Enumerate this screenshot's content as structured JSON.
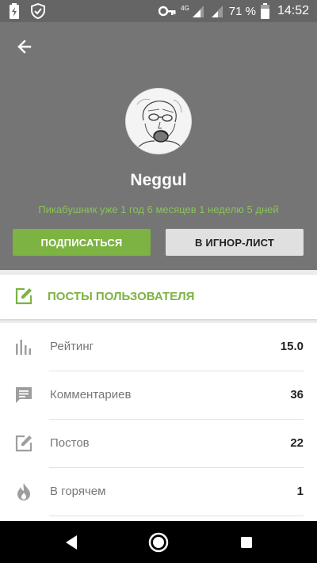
{
  "status_bar": {
    "battery_percent": "71 %",
    "time": "14:52",
    "network_label": "4G"
  },
  "profile": {
    "username": "Neggul",
    "member_since": "Пикабушник уже 1 год 6 месяцев 1 неделю 5 дней",
    "subscribe_label": "ПОДПИСАТЬСЯ",
    "ignore_label": "В ИГНОР-ЛИСТ"
  },
  "posts_link": {
    "label": "ПОСТЫ ПОЛЬЗОВАТЕЛЯ"
  },
  "stats": [
    {
      "label": "Рейтинг",
      "value": "15.0",
      "icon": "bar-chart-icon"
    },
    {
      "label": "Комментариев",
      "value": "36",
      "icon": "comment-icon"
    },
    {
      "label": "Постов",
      "value": "22",
      "icon": "edit-icon"
    },
    {
      "label": "В горячем",
      "value": "1",
      "icon": "fire-icon"
    }
  ],
  "colors": {
    "accent": "#7cb342",
    "header": "#757575",
    "status_bar": "#656565"
  }
}
